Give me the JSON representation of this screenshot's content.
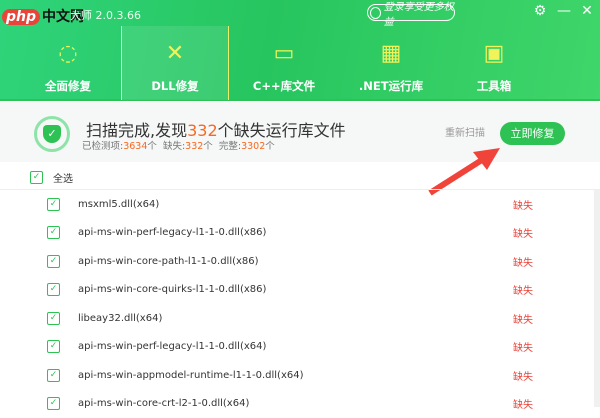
{
  "window": {
    "watermark": "php中文网",
    "version": "大师 2.0.3.66",
    "login": "登录享受更多权益"
  },
  "nav": [
    {
      "label": "全面修复"
    },
    {
      "label": "DLL修复"
    },
    {
      "label": "C++库文件"
    },
    {
      "label": ".NET运行库"
    },
    {
      "label": "工具箱"
    }
  ],
  "summary": {
    "prefix": "扫描完成,发现",
    "count": "332",
    "suffix": "个缺失运行库文件",
    "detected_label": "已检测项:",
    "detected": "3634",
    "unit": "个",
    "missing_label": "缺失:",
    "missing": "332",
    "complete_label": "完整:",
    "complete": "3302",
    "rescan": "重新扫描",
    "fix": "立即修复"
  },
  "select_all": "全选",
  "items": [
    {
      "name": "msxml5.dll(x64)",
      "status": "缺失"
    },
    {
      "name": "api-ms-win-perf-legacy-l1-1-0.dll(x86)",
      "status": "缺失"
    },
    {
      "name": "api-ms-win-core-path-l1-1-0.dll(x86)",
      "status": "缺失"
    },
    {
      "name": "api-ms-win-core-quirks-l1-1-0.dll(x86)",
      "status": "缺失"
    },
    {
      "name": "libeay32.dll(x64)",
      "status": "缺失"
    },
    {
      "name": "api-ms-win-perf-legacy-l1-1-0.dll(x64)",
      "status": "缺失"
    },
    {
      "name": "api-ms-win-appmodel-runtime-l1-1-0.dll(x64)",
      "status": "缺失"
    },
    {
      "name": "api-ms-win-core-crt-l2-1-0.dll(x64)",
      "status": "缺失"
    }
  ]
}
